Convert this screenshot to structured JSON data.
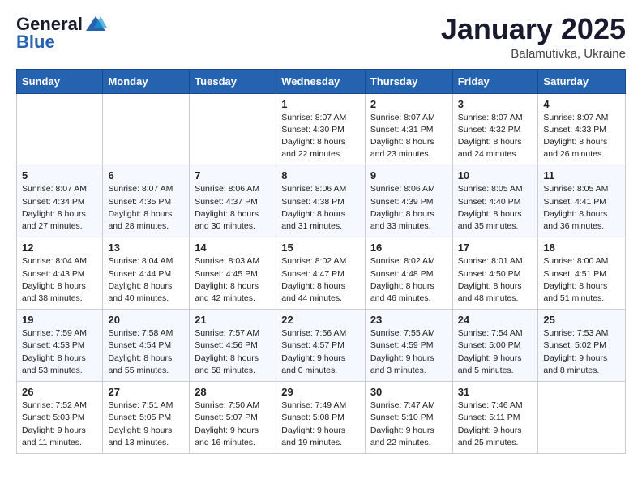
{
  "header": {
    "logo_line1": "General",
    "logo_line2": "Blue",
    "month_title": "January 2025",
    "location": "Balamutivka, Ukraine"
  },
  "weekdays": [
    "Sunday",
    "Monday",
    "Tuesday",
    "Wednesday",
    "Thursday",
    "Friday",
    "Saturday"
  ],
  "weeks": [
    [
      {
        "day": "",
        "info": ""
      },
      {
        "day": "",
        "info": ""
      },
      {
        "day": "",
        "info": ""
      },
      {
        "day": "1",
        "info": "Sunrise: 8:07 AM\nSunset: 4:30 PM\nDaylight: 8 hours and 22 minutes."
      },
      {
        "day": "2",
        "info": "Sunrise: 8:07 AM\nSunset: 4:31 PM\nDaylight: 8 hours and 23 minutes."
      },
      {
        "day": "3",
        "info": "Sunrise: 8:07 AM\nSunset: 4:32 PM\nDaylight: 8 hours and 24 minutes."
      },
      {
        "day": "4",
        "info": "Sunrise: 8:07 AM\nSunset: 4:33 PM\nDaylight: 8 hours and 26 minutes."
      }
    ],
    [
      {
        "day": "5",
        "info": "Sunrise: 8:07 AM\nSunset: 4:34 PM\nDaylight: 8 hours and 27 minutes."
      },
      {
        "day": "6",
        "info": "Sunrise: 8:07 AM\nSunset: 4:35 PM\nDaylight: 8 hours and 28 minutes."
      },
      {
        "day": "7",
        "info": "Sunrise: 8:06 AM\nSunset: 4:37 PM\nDaylight: 8 hours and 30 minutes."
      },
      {
        "day": "8",
        "info": "Sunrise: 8:06 AM\nSunset: 4:38 PM\nDaylight: 8 hours and 31 minutes."
      },
      {
        "day": "9",
        "info": "Sunrise: 8:06 AM\nSunset: 4:39 PM\nDaylight: 8 hours and 33 minutes."
      },
      {
        "day": "10",
        "info": "Sunrise: 8:05 AM\nSunset: 4:40 PM\nDaylight: 8 hours and 35 minutes."
      },
      {
        "day": "11",
        "info": "Sunrise: 8:05 AM\nSunset: 4:41 PM\nDaylight: 8 hours and 36 minutes."
      }
    ],
    [
      {
        "day": "12",
        "info": "Sunrise: 8:04 AM\nSunset: 4:43 PM\nDaylight: 8 hours and 38 minutes."
      },
      {
        "day": "13",
        "info": "Sunrise: 8:04 AM\nSunset: 4:44 PM\nDaylight: 8 hours and 40 minutes."
      },
      {
        "day": "14",
        "info": "Sunrise: 8:03 AM\nSunset: 4:45 PM\nDaylight: 8 hours and 42 minutes."
      },
      {
        "day": "15",
        "info": "Sunrise: 8:02 AM\nSunset: 4:47 PM\nDaylight: 8 hours and 44 minutes."
      },
      {
        "day": "16",
        "info": "Sunrise: 8:02 AM\nSunset: 4:48 PM\nDaylight: 8 hours and 46 minutes."
      },
      {
        "day": "17",
        "info": "Sunrise: 8:01 AM\nSunset: 4:50 PM\nDaylight: 8 hours and 48 minutes."
      },
      {
        "day": "18",
        "info": "Sunrise: 8:00 AM\nSunset: 4:51 PM\nDaylight: 8 hours and 51 minutes."
      }
    ],
    [
      {
        "day": "19",
        "info": "Sunrise: 7:59 AM\nSunset: 4:53 PM\nDaylight: 8 hours and 53 minutes."
      },
      {
        "day": "20",
        "info": "Sunrise: 7:58 AM\nSunset: 4:54 PM\nDaylight: 8 hours and 55 minutes."
      },
      {
        "day": "21",
        "info": "Sunrise: 7:57 AM\nSunset: 4:56 PM\nDaylight: 8 hours and 58 minutes."
      },
      {
        "day": "22",
        "info": "Sunrise: 7:56 AM\nSunset: 4:57 PM\nDaylight: 9 hours and 0 minutes."
      },
      {
        "day": "23",
        "info": "Sunrise: 7:55 AM\nSunset: 4:59 PM\nDaylight: 9 hours and 3 minutes."
      },
      {
        "day": "24",
        "info": "Sunrise: 7:54 AM\nSunset: 5:00 PM\nDaylight: 9 hours and 5 minutes."
      },
      {
        "day": "25",
        "info": "Sunrise: 7:53 AM\nSunset: 5:02 PM\nDaylight: 9 hours and 8 minutes."
      }
    ],
    [
      {
        "day": "26",
        "info": "Sunrise: 7:52 AM\nSunset: 5:03 PM\nDaylight: 9 hours and 11 minutes."
      },
      {
        "day": "27",
        "info": "Sunrise: 7:51 AM\nSunset: 5:05 PM\nDaylight: 9 hours and 13 minutes."
      },
      {
        "day": "28",
        "info": "Sunrise: 7:50 AM\nSunset: 5:07 PM\nDaylight: 9 hours and 16 minutes."
      },
      {
        "day": "29",
        "info": "Sunrise: 7:49 AM\nSunset: 5:08 PM\nDaylight: 9 hours and 19 minutes."
      },
      {
        "day": "30",
        "info": "Sunrise: 7:47 AM\nSunset: 5:10 PM\nDaylight: 9 hours and 22 minutes."
      },
      {
        "day": "31",
        "info": "Sunrise: 7:46 AM\nSunset: 5:11 PM\nDaylight: 9 hours and 25 minutes."
      },
      {
        "day": "",
        "info": ""
      }
    ]
  ]
}
